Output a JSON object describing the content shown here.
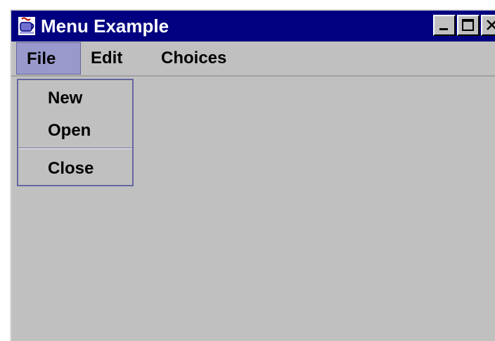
{
  "window": {
    "title": "Menu Example",
    "app_icon": "java-coffee-cup-icon",
    "controls": {
      "minimize_icon": "minimize-icon",
      "maximize_icon": "maximize-icon",
      "close_icon": "close-icon"
    }
  },
  "menubar": {
    "items": [
      {
        "label": "File",
        "open": true
      },
      {
        "label": "Edit"
      },
      {
        "label": "Choices"
      }
    ]
  },
  "file_menu": {
    "items": [
      {
        "label": "New"
      },
      {
        "label": "Open"
      },
      {
        "label": "Close"
      }
    ]
  },
  "colors": {
    "titlebar": "#000080",
    "menu_highlight": "#9999cc",
    "background": "#c0c0c0"
  }
}
